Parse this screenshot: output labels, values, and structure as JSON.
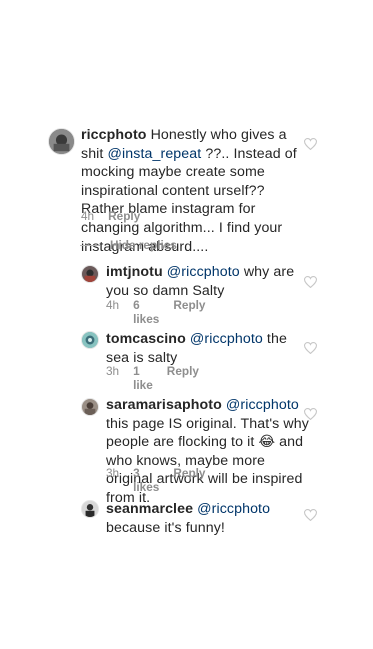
{
  "comments": [
    {
      "username": "riccphoto",
      "text_part1": " Honestly who gives a shit ",
      "mention": "@insta_repeat",
      "text_part2": " ??.. Instead of mocking maybe create some inspirational content urself?? Rather blame instagram for changing algorithm... I find your instagram absurd....",
      "time": "4h",
      "reply_label": "Reply"
    },
    {
      "username": "imtjnotu",
      "mention": "@riccphoto",
      "text": " why are you so damn Salty",
      "time": "4h",
      "likes": "6 likes",
      "reply_label": "Reply"
    },
    {
      "username": "tomcascino",
      "mention": "@riccphoto",
      "text": " the sea is salty",
      "time": "3h",
      "likes": "1 like",
      "reply_label": "Reply"
    },
    {
      "username": "saramarisaphoto",
      "mention": "@riccphoto",
      "text_part1": " this page IS original. That's why people are flocking to it ",
      "emoji": "😂",
      "text_part2": " and who knows, maybe more original artwork will be inspired from it.",
      "time": "3h",
      "likes": "3 likes",
      "reply_label": "Reply"
    },
    {
      "username": "seanmarclee",
      "mention": "@riccphoto",
      "text": " because it's funny!"
    }
  ],
  "hide_replies_label": "Hide replies",
  "icons": {
    "like": "heart-outline-icon"
  },
  "colors": {
    "text": "#262626",
    "meta": "#8e8e8e",
    "mention": "#003569",
    "heart": "#c7c7c7"
  }
}
